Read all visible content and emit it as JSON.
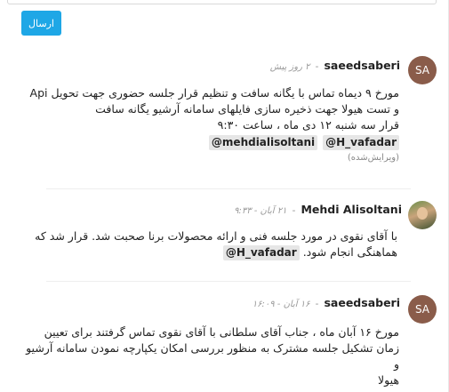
{
  "send_button": "ارسال",
  "comments": [
    {
      "author": "saeedsaberi",
      "avatar_initials": "SA",
      "time": "۲ روز پیش",
      "lines": [
        "مورخ ۹ دیماه تماس با یگانه سافت و تنظیم قرار جلسه حضوری جهت تحویل Api",
        "و تست هیولا جهت ذخیره سازی فایلهای سامانه آرشیو یگانه سافت",
        "قرار سه شنبه ۱۲ دی ماه ، ساعت ۹:۳۰"
      ],
      "mentions": [
        "@H_vafadar",
        "@mehdialisoltani"
      ],
      "edited": "(ویرایش‌شده)"
    },
    {
      "author": "Mehdi Alisoltani",
      "time": "۲۱ آبان - ۹:۳۳",
      "lines": [
        "با آقای نقوی در مورد جلسه فنی و ارائه محصولات برنا صحبت شد. قرار شد که",
        "هماهنگی انجام شود."
      ],
      "mention": "@H_vafadar"
    },
    {
      "author": "saeedsaberi",
      "avatar_initials": "SA",
      "time": "۱۶ آبان - ۱۶:۰۹",
      "lines": [
        "مورخ ۱۶ آبان ماه ، جناب آقای سلطانی با آقای نقوی تماس گرفتند برای تعیین",
        "زمان تشکیل جلسه مشترک به منظور بررسی امکان یکپارچه نمودن سامانه آرشیو و",
        "هیولا"
      ]
    }
  ]
}
